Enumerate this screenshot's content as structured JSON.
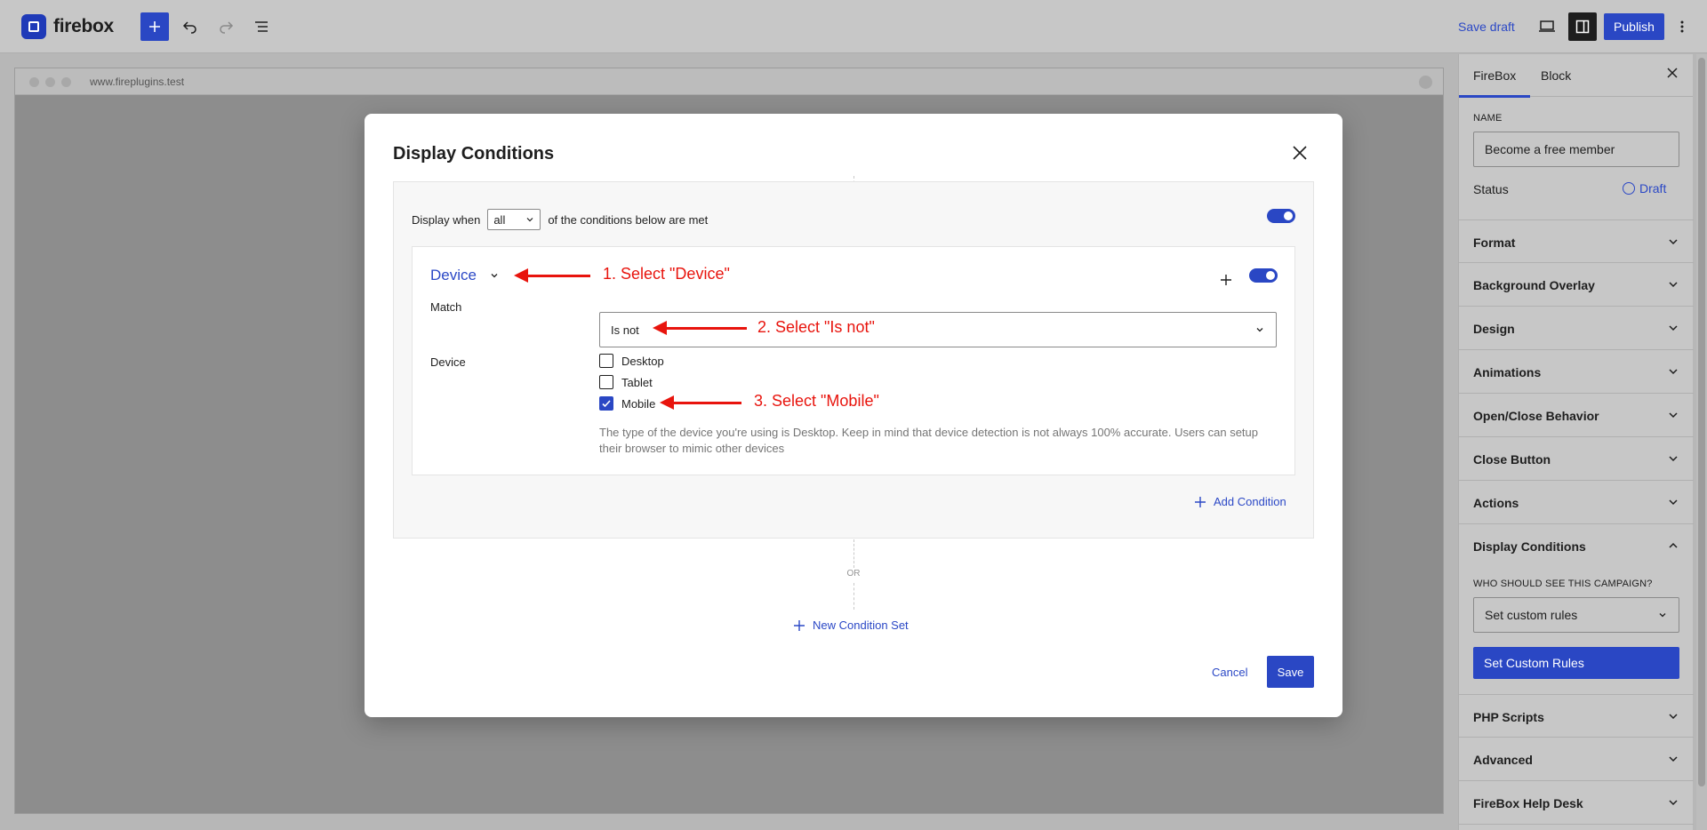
{
  "app": {
    "logo_text": "firebox",
    "save_draft": "Save draft",
    "publish": "Publish"
  },
  "canvas": {
    "url": "www.fireplugins.test"
  },
  "sidebar": {
    "tabs": [
      "FireBox",
      "Block"
    ],
    "name_label": "NAME",
    "name_value": "Become a free member",
    "status_label": "Status",
    "status_value": "Draft",
    "panels": [
      "Format",
      "Background Overlay",
      "Design",
      "Animations",
      "Open/Close Behavior",
      "Close Button",
      "Actions",
      "Display Conditions",
      "PHP Scripts",
      "Advanced",
      "FireBox Help Desk"
    ],
    "who_label": "WHO SHOULD SEE THIS CAMPAIGN?",
    "who_value": "Set custom rules",
    "custom_rules_button": "Set Custom Rules"
  },
  "modal": {
    "title": "Display Conditions",
    "display_when_prefix": "Display when",
    "display_when_value": "all",
    "display_when_suffix": "of the conditions below are met",
    "condition_type": "Device",
    "match_label": "Match",
    "match_value": "Is not",
    "device_label": "Device",
    "devices": [
      {
        "label": "Desktop",
        "checked": false
      },
      {
        "label": "Tablet",
        "checked": false
      },
      {
        "label": "Mobile",
        "checked": true
      }
    ],
    "help_text": "The type of the device you're using is Desktop. Keep in mind that device detection is not always 100% accurate. Users can setup their browser to mimic other devices",
    "add_condition": "Add Condition",
    "or_label": "OR",
    "new_condition_set": "New Condition Set",
    "cancel": "Cancel",
    "save": "Save"
  },
  "annotations": {
    "step1": "1. Select \"Device\"",
    "step2": "2. Select \"Is not\"",
    "step3": "3. Select \"Mobile\""
  },
  "colors": {
    "accent": "#2a47c4",
    "annotation": "#e8140d"
  }
}
